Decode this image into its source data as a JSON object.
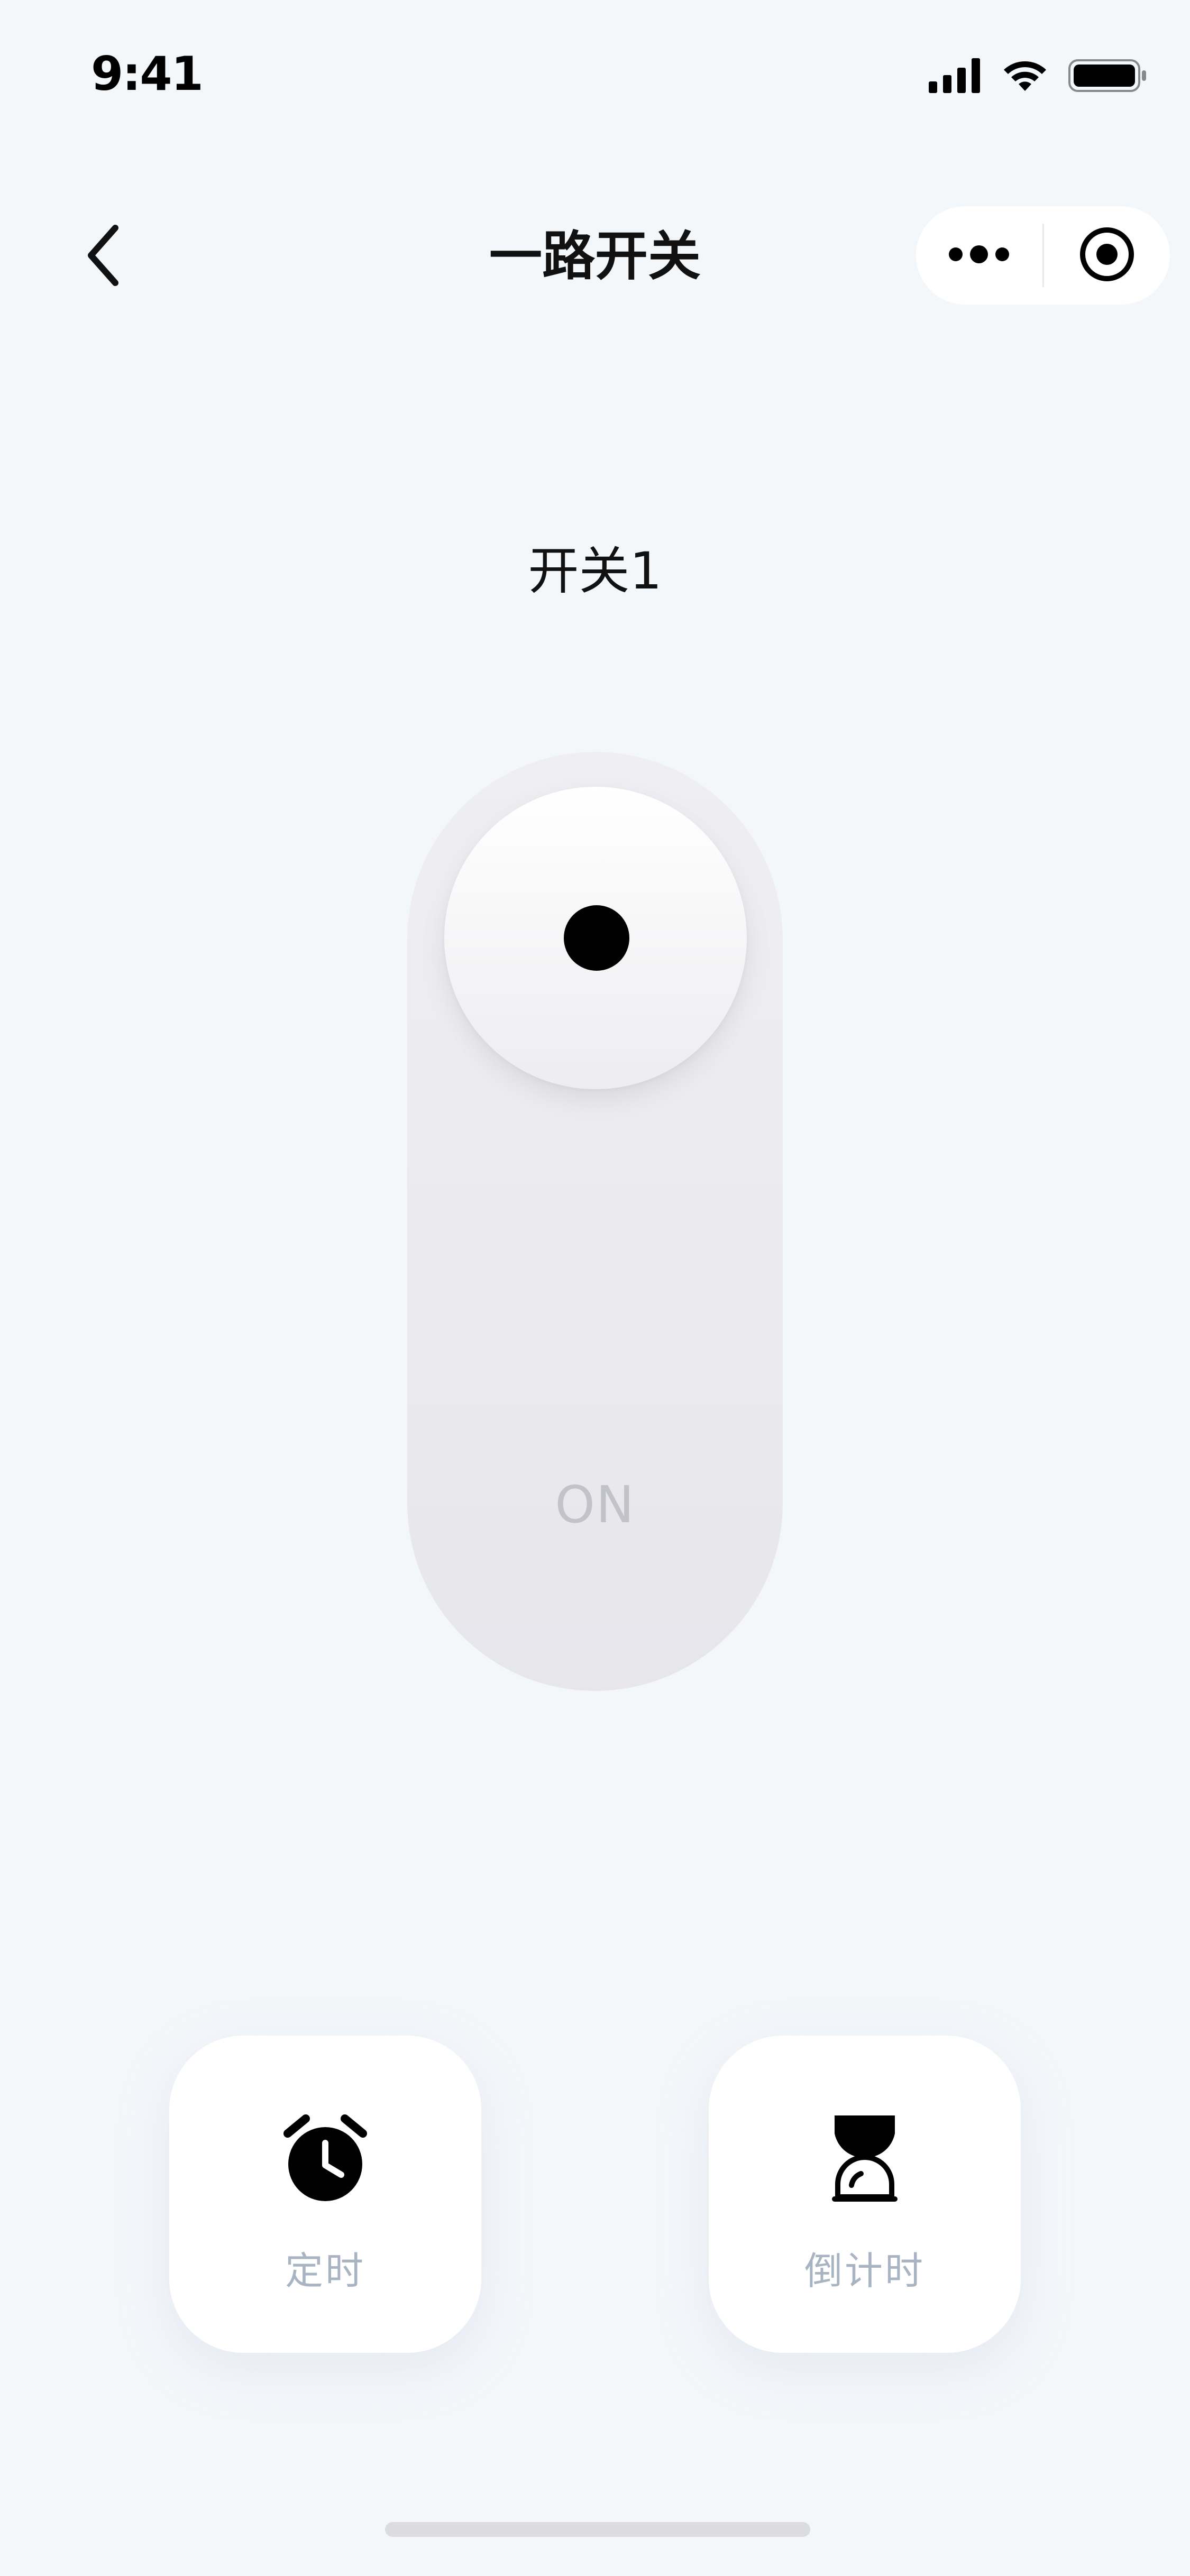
{
  "status_bar": {
    "time": "9:41",
    "icons": [
      "signal-icon",
      "wifi-icon",
      "battery-icon"
    ]
  },
  "nav": {
    "title": "一路开关",
    "back_icon": "chevron-left-icon",
    "more_icon": "more-dots-icon",
    "close_icon": "target-circle-icon"
  },
  "switch": {
    "label": "开关1",
    "state": "ON"
  },
  "actions": [
    {
      "label": "定时",
      "icon": "alarm-clock-icon"
    },
    {
      "label": "倒计时",
      "icon": "hourglass-icon"
    }
  ],
  "colors": {
    "background": "#F4F7FA",
    "card": "#FFFFFF",
    "label_muted": "#A9B4C3",
    "state_text": "#C2C3C8",
    "toggle_dot": "#000000"
  }
}
